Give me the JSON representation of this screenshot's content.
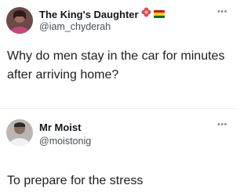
{
  "tweets": [
    {
      "display_name": "The King's Daughter",
      "handle": "@iam_chyderah",
      "text": "Why do men stay in the car for minutes after arriving home?",
      "name_emoji": "flower-emoji",
      "flag": "ghana-flag",
      "more_icon": "more-icon"
    },
    {
      "display_name": "Mr Moist",
      "handle": "@moistonig",
      "text": "To prepare for the stress",
      "more_icon": "more-icon"
    }
  ],
  "colors": {
    "text_primary": "#14171a",
    "text_secondary": "#4a4f55",
    "divider": "#ececec",
    "flower": "#d8486a",
    "flag_red": "#ce1126",
    "flag_yellow": "#fcd116",
    "flag_green": "#006b3f"
  }
}
